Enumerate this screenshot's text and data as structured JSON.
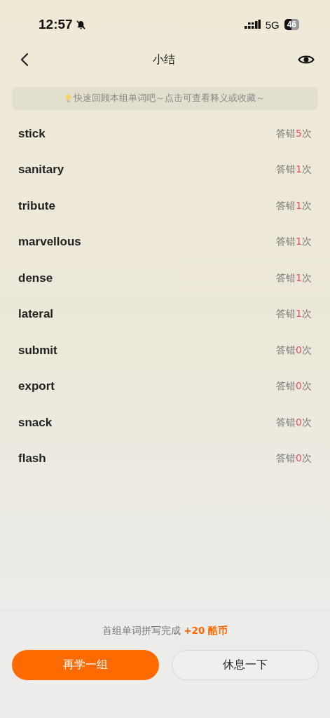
{
  "status_bar": {
    "time": "12:57",
    "network": "5G",
    "battery": "46"
  },
  "nav": {
    "title": "小结"
  },
  "tip": "快速回顾本组单词吧～点击可查看释义或收藏～",
  "words": [
    {
      "word": "stick",
      "prefix": "答错",
      "count": "5",
      "suffix": "次"
    },
    {
      "word": "sanitary",
      "prefix": "答错",
      "count": "1",
      "suffix": "次"
    },
    {
      "word": "tribute",
      "prefix": "答错",
      "count": "1",
      "suffix": "次"
    },
    {
      "word": "marvellous",
      "prefix": "答错",
      "count": "1",
      "suffix": "次"
    },
    {
      "word": "dense",
      "prefix": "答错",
      "count": "1",
      "suffix": "次"
    },
    {
      "word": "lateral",
      "prefix": "答错",
      "count": "1",
      "suffix": "次"
    },
    {
      "word": "submit",
      "prefix": "答错",
      "count": "0",
      "suffix": "次"
    },
    {
      "word": "export",
      "prefix": "答错",
      "count": "0",
      "suffix": "次"
    },
    {
      "word": "snack",
      "prefix": "答错",
      "count": "0",
      "suffix": "次"
    },
    {
      "word": "flash",
      "prefix": "答错",
      "count": "0",
      "suffix": "次"
    }
  ],
  "footer": {
    "message": "首组单词拼写完成",
    "reward": "+20 酷币",
    "primary_button": "再学一组",
    "secondary_button": "休息一下"
  }
}
